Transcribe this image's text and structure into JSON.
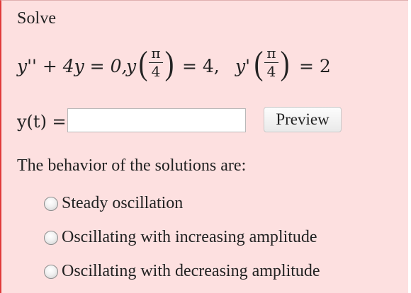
{
  "question": {
    "prompt": "Solve",
    "equation": {
      "de": "y'' + 4y = 0,",
      "cond1_func": "y",
      "cond1_num": "π",
      "cond1_den": "4",
      "cond1_rhs": "= 4,",
      "cond2_func": "y'",
      "cond2_num": "π",
      "cond2_den": "4",
      "cond2_rhs": "= 2"
    }
  },
  "answer": {
    "label": "y(t) =",
    "value": "",
    "preview_label": "Preview"
  },
  "behavior": {
    "prompt": "The behavior of the solutions are:",
    "options": [
      {
        "label": "Steady oscillation",
        "selected": false
      },
      {
        "label": "Oscillating with increasing amplitude",
        "selected": false
      },
      {
        "label": "Oscillating with decreasing amplitude",
        "selected": false
      }
    ]
  },
  "colors": {
    "panel_background": "#fde0e0",
    "panel_left_border": "#e03a3a"
  }
}
